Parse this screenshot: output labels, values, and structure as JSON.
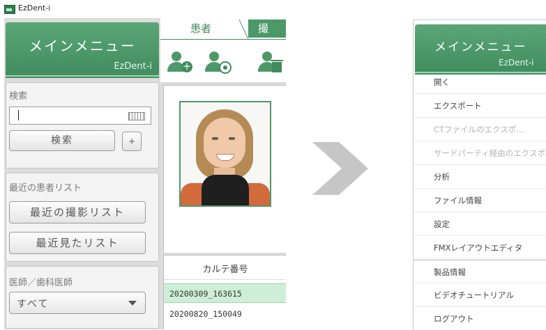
{
  "window": {
    "title": "EzDent-i"
  },
  "main_menu": {
    "title": "メインメニュー",
    "brand": "EzDent-i"
  },
  "tabs": [
    {
      "label": "患者",
      "active": true
    },
    {
      "label": "撮",
      "active": false
    }
  ],
  "toolbar": {
    "icons": [
      "add-patient-icon",
      "search-patient-icon",
      "delete-patient-icon"
    ]
  },
  "search": {
    "title": "検索",
    "value": "",
    "button_label": "検索",
    "plus_label": "+"
  },
  "recent": {
    "title": "最近の患者リスト",
    "recent_shots_label": "最近の撮影リスト",
    "recently_viewed_label": "最近見たリスト"
  },
  "doctor": {
    "title": "医師／歯科医師",
    "selected": "すべて"
  },
  "patient_list": {
    "header": "カルテ番号",
    "rows": [
      "20200309_163615",
      "20200820_150049"
    ],
    "selected_index": 0
  },
  "dropdown_menu": {
    "title": "メインメニュー",
    "brand": "EzDent-i",
    "items": [
      {
        "label": "開く",
        "enabled": true
      },
      {
        "label": "エクスポート",
        "enabled": true
      },
      {
        "label": "CTファイルのエクスポ…",
        "enabled": false
      },
      {
        "label": "サードパーティ経由のエクスポ",
        "enabled": false
      },
      {
        "label": "分析",
        "enabled": true
      },
      {
        "label": "ファイル情報",
        "enabled": true
      },
      {
        "label": "設定",
        "enabled": true
      },
      {
        "label": "FMXレイアウトエディタ",
        "enabled": true
      },
      {
        "label": "製品情報",
        "enabled": true
      },
      {
        "label": "ビデオチュートリアル",
        "enabled": true
      },
      {
        "label": "ログアウト",
        "enabled": true
      }
    ]
  },
  "colors": {
    "accent": "#4c9868",
    "selected_row": "#cfeed8",
    "disabled_text": "#b3b3b3"
  }
}
